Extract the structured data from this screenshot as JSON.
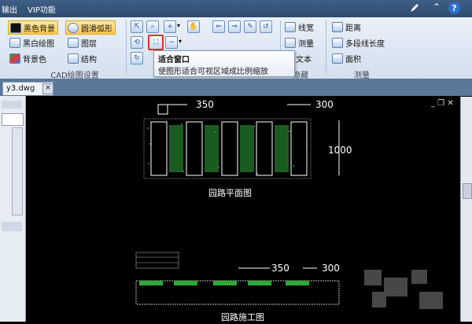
{
  "titlebar": {
    "menu_left": "输出",
    "menu_vip": "VIP功能"
  },
  "ribbon": {
    "group1": {
      "items": [
        "黑色背景",
        "黑白绘图",
        "背景色",
        "圆滑弧形",
        "图层",
        "结构"
      ],
      "label": "CAD绘图设置"
    },
    "group_view": {
      "label": ""
    },
    "group_hide": {
      "items": [
        "线宽",
        "测量",
        "文本"
      ],
      "label": "隐藏"
    },
    "group_measure": {
      "items": [
        "距离",
        "多段线长度",
        "面积"
      ],
      "label": "测量"
    },
    "fit_window_highlighted": true
  },
  "tooltip": {
    "title": "适合窗口",
    "desc": "使图形适合可视区域成比例缩放"
  },
  "tabs": {
    "file_tab": "y3.dwg"
  },
  "drawing": {
    "plan": {
      "dim_top_left": "350",
      "dim_top_right": "300",
      "dim_side": "1000",
      "caption": "园路平面图"
    },
    "section": {
      "dim_left": "350",
      "dim_right": "300",
      "caption": "园路施工图"
    }
  },
  "colors": {
    "highlight_red": "#e03030",
    "ribbon_active": "#ffcc4d"
  }
}
